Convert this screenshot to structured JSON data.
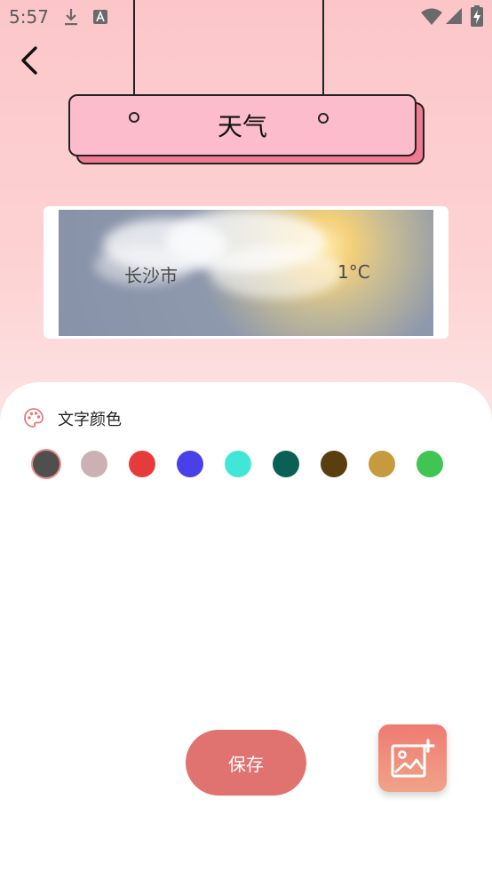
{
  "status_bar": {
    "time": "5:57",
    "icons": [
      "download-icon",
      "a-badge-icon",
      "wifi-icon",
      "signal-icon",
      "battery-charging-icon"
    ]
  },
  "nav": {
    "back_icon": "chevron-left-icon"
  },
  "header": {
    "title": "天气"
  },
  "weather_card": {
    "city": "长沙市",
    "temperature": "1°C"
  },
  "text_color": {
    "label": "文字颜色",
    "icon": "palette-icon",
    "selected_index": 0,
    "swatches": [
      "#4f4f4f",
      "#cdb0b3",
      "#e63b3b",
      "#4a40e8",
      "#40e6d8",
      "#0b6056",
      "#5a3e0f",
      "#c69a3f",
      "#40c454"
    ]
  },
  "actions": {
    "save_label": "保存",
    "add_image_icon": "add-image-icon"
  }
}
